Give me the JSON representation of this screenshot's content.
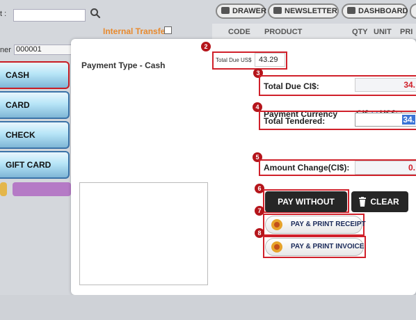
{
  "background": {
    "account_label": "t :",
    "internal_transfer": "Internal Transfer",
    "customer_label": "ner :",
    "customer_value": "000001",
    "payment_buttons": [
      "CASH",
      "CARD",
      "CHECK",
      "GIFT CARD"
    ]
  },
  "topbar": {
    "tabs": [
      "DRAWER",
      "NEWSLETTER",
      "DASHBOARD"
    ],
    "columns": [
      "CODE",
      "PRODUCT",
      "QTY",
      "UNIT",
      "PRI"
    ]
  },
  "modal": {
    "title": "Payment Type - Cash",
    "total_due_us_label": "Total Due US$",
    "total_due_us_value": "43.29",
    "total_due_ci_label": "Total Due CI$:",
    "total_due_ci_value": "34.",
    "payment_currency_label": "Payment Currency",
    "currency_ci": "CI$",
    "currency_us": "US$",
    "total_tendered_label": "Total Tendered:",
    "total_tendered_value": "34.",
    "amount_change_label": "Amount Change(CI$):",
    "amount_change_value": "0.",
    "pay_without_print": "PAY WITHOUT PRINT",
    "clear": "CLEAR",
    "pay_print_receipt": "PAY & PRINT RECEIPT",
    "pay_print_invoice": "PAY & PRINT INVOICE"
  },
  "callouts": [
    "2",
    "3",
    "4",
    "5",
    "6",
    "7",
    "8"
  ],
  "colors": {
    "accent_red": "#d0202a",
    "internal_transfer": "#e88a2e",
    "amount_red": "#d0202a"
  }
}
